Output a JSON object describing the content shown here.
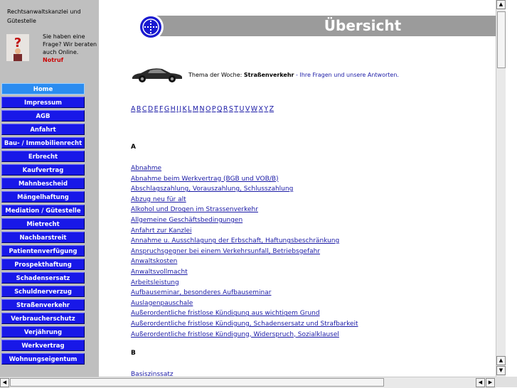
{
  "firm": {
    "line1": "Rechtsanwaltskanzlei und Gütestelle"
  },
  "help": {
    "text": "Sie haben eine Frage? Wir beraten auch Online.",
    "notruf": "Notruf"
  },
  "nav": [
    "Home",
    "Impressum",
    "AGB",
    "Anfahrt",
    "Bau- / Immobilienrecht",
    "Erbrecht",
    "Kaufvertrag",
    "Mahnbescheid",
    "Mängelhaftung",
    "Mediation / Gütestelle",
    "Mietrecht",
    "Nachbarstreit",
    "Patientenverfügung",
    "Prospekthaftung",
    "Schadensersatz",
    "Schuldnerverzug",
    "Straßenverkehr",
    "Verbraucherschutz",
    "Verjährung",
    "Werkvertrag",
    "Wohnungseigentum"
  ],
  "banner": {
    "title": "Übersicht"
  },
  "topic": {
    "prefix": "Thema der Woche: ",
    "subject": "Straßenverkehr",
    "rest": " - Ihre Fragen und unsere Antworten."
  },
  "alphabet": [
    "A",
    "B",
    "C",
    "D",
    "E",
    "F",
    "G",
    "H",
    "I",
    "J",
    "K",
    "L",
    "M",
    "N",
    "O",
    "P",
    "Q",
    "R",
    "S",
    "T",
    "U",
    "V",
    "W",
    "X",
    "Y",
    "Z"
  ],
  "sections": {
    "a": "A",
    "b": "B"
  },
  "links_a": [
    "Abnahme",
    "Abnahme beim Werkvertrag (BGB und VOB/B)",
    "Abschlagszahlung, Vorauszahlung, Schlusszahlung",
    "Abzug neu für alt",
    "Alkohol und Drogen im Strassenverkehr",
    "Allgemeine Geschäftsbedingungen",
    "Anfahrt zur Kanzlei",
    "Annahme u. Ausschlagung der Erbschaft, Haftungsbeschränkung",
    "Anspruchsgegner bei einem Verkehrsunfall, Betriebsgefahr",
    "Anwaltskosten",
    "Anwaltsvollmacht",
    "Arbeitsleistung",
    "Aufbauseminar, besonderes Aufbauseminar",
    "Auslagenpauschale",
    "Außerordentliche fristlose Kündigung aus wichtigem Grund",
    "Außerordentliche fristlose Kündigung, Schadensersatz und Strafbarkeit",
    "Außerordentliche fristlose Kündigung, Widerspruch, Sozialklausel"
  ],
  "links_b": [
    "Basiszinssatz"
  ],
  "colors": {
    "nav_bg": "#1818e8",
    "nav_active": "#2b8cf0",
    "link": "#1a1aa6",
    "sidebar": "#bfbfbf",
    "banner": "#9b9b9b"
  }
}
